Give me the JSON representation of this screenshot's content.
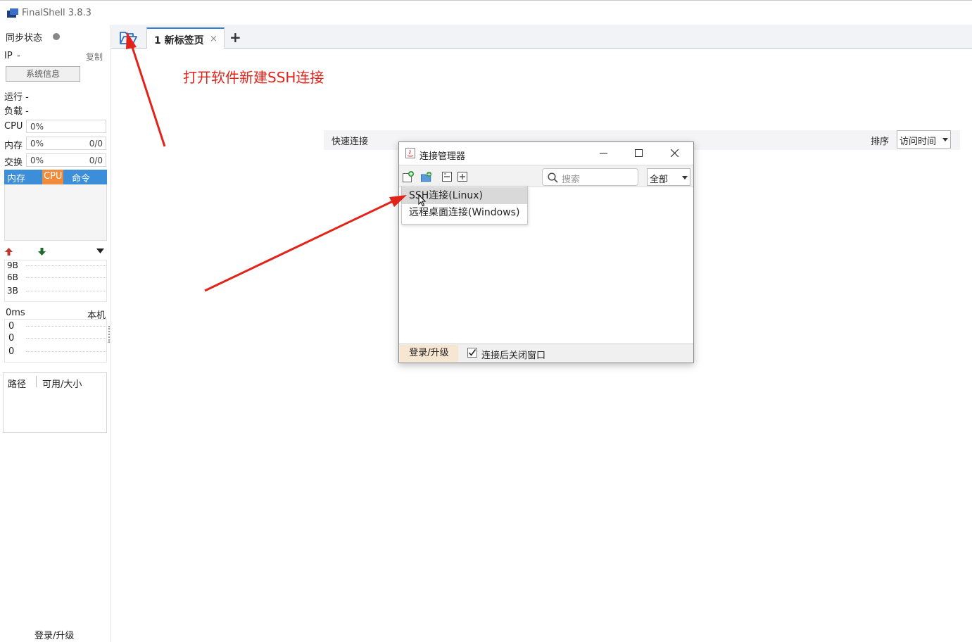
{
  "window": {
    "title": "FinalShell 3.8.3"
  },
  "sidebar": {
    "sync_status_label": "同步状态",
    "ip_label": "IP",
    "ip_value": "-",
    "copy_label": "复制",
    "sys_info_button": "系统信息",
    "running_label": "运行 -",
    "load_label": "负载 -",
    "cpu": {
      "label": "CPU",
      "percent": "0%"
    },
    "memory": {
      "label": "内存",
      "percent": "0%",
      "value": "0/0"
    },
    "swap": {
      "label": "交换",
      "percent": "0%",
      "value": "0/0"
    },
    "process_tabs": [
      "内存",
      "CPU",
      "命令"
    ],
    "net_ticks": [
      "9B",
      "6B",
      "3B"
    ],
    "latency_label": "0ms",
    "host_label": "本机",
    "latency_values": [
      "0",
      "0",
      "0"
    ],
    "fs_columns": [
      "路径",
      "可用/大小"
    ],
    "login_label": "登录/升级"
  },
  "tabs": {
    "items": [
      {
        "label": "1 新标签页",
        "close": "×"
      }
    ],
    "add_label": "+"
  },
  "annotation": {
    "text": "打开软件新建SSH连接",
    "color": "#e2231a"
  },
  "quick_connect": {
    "label": "快速连接",
    "sort_label": "排序",
    "sort_value": "访问时间"
  },
  "dialog": {
    "title": "连接管理器",
    "search_placeholder": "搜索",
    "filter_value": "全部",
    "menu_items": [
      "SSH连接(Linux)",
      "远程桌面连接(Windows)"
    ],
    "footer": {
      "login_label": "登录/升级",
      "close_after_connect_label": "连接后关闭窗口",
      "close_after_connect_checked": true
    }
  },
  "colors": {
    "accent": "#2f7fd7",
    "tab_blue": "#3d8ed8",
    "tab_orange": "#f08a3c",
    "arrow": "#e2231a"
  }
}
